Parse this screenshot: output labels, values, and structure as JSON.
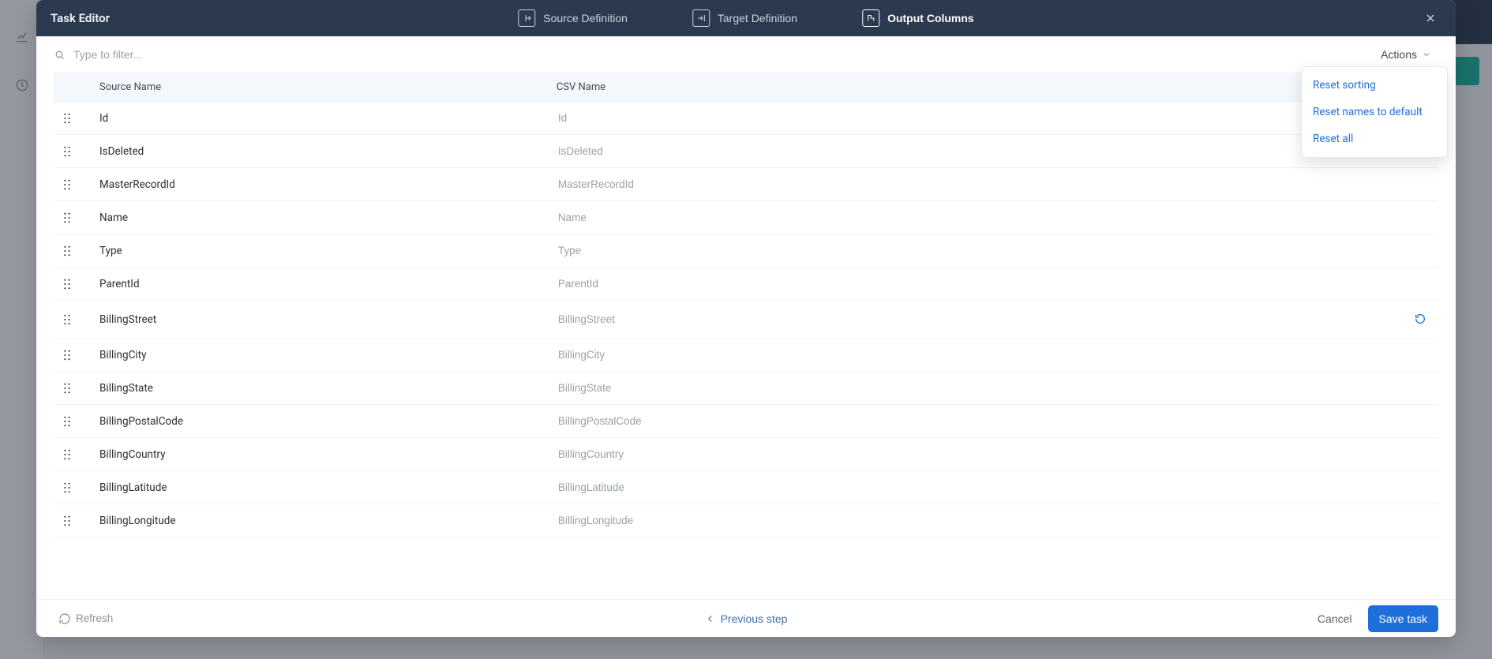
{
  "header": {
    "title": "Task Editor",
    "tabs": [
      {
        "label": "Source Definition",
        "icon": "source-icon",
        "active": false
      },
      {
        "label": "Target Definition",
        "icon": "target-icon",
        "active": false
      },
      {
        "label": "Output Columns",
        "icon": "output-icon",
        "active": true
      }
    ]
  },
  "filter": {
    "placeholder": "Type to filter...",
    "actions_label": "Actions",
    "dropdown": [
      "Reset sorting",
      "Reset names to default",
      "Reset all"
    ]
  },
  "table": {
    "headers": {
      "source_name": "Source Name",
      "csv_name": "CSV Name"
    },
    "rows": [
      {
        "source": "Id",
        "csv": "Id"
      },
      {
        "source": "IsDeleted",
        "csv": "IsDeleted"
      },
      {
        "source": "MasterRecordId",
        "csv": "MasterRecordId"
      },
      {
        "source": "Name",
        "csv": "Name"
      },
      {
        "source": "Type",
        "csv": "Type"
      },
      {
        "source": "ParentId",
        "csv": "ParentId"
      },
      {
        "source": "BillingStreet",
        "csv": "BillingStreet",
        "resetVisible": true
      },
      {
        "source": "BillingCity",
        "csv": "BillingCity"
      },
      {
        "source": "BillingState",
        "csv": "BillingState"
      },
      {
        "source": "BillingPostalCode",
        "csv": "BillingPostalCode"
      },
      {
        "source": "BillingCountry",
        "csv": "BillingCountry"
      },
      {
        "source": "BillingLatitude",
        "csv": "BillingLatitude"
      },
      {
        "source": "BillingLongitude",
        "csv": "BillingLongitude"
      }
    ]
  },
  "footer": {
    "refresh": "Refresh",
    "previous": "Previous step",
    "cancel": "Cancel",
    "save": "Save task"
  }
}
